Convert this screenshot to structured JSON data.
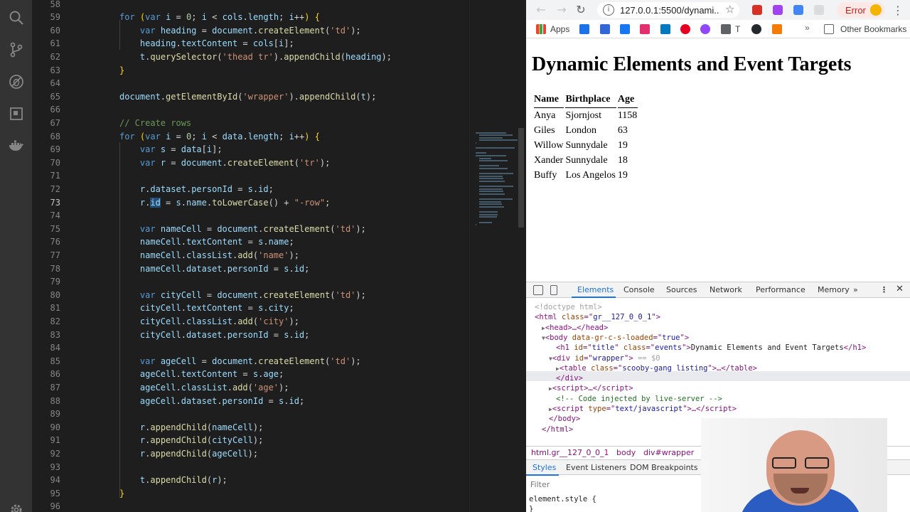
{
  "editor": {
    "lines": [
      {
        "n": "58",
        "html": ""
      },
      {
        "n": "59",
        "html": "<span class=\"k\">for</span> <span class=\"y\">(</span><span class=\"k\">var</span> <span class=\"v\">i</span> = <span class=\"n\">0</span>; <span class=\"v\">i</span> &lt; <span class=\"v\">cols</span>.<span class=\"v\">length</span>; <span class=\"v\">i</span>++<span class=\"y\">)</span> <span class=\"y\">{</span>"
      },
      {
        "n": "60",
        "html": "    <span class=\"k\">var</span> <span class=\"v\">heading</span> = <span class=\"v\">document</span>.<span class=\"f\">createElement</span>(<span class=\"s\">'td'</span>);"
      },
      {
        "n": "61",
        "html": "    <span class=\"v\">heading</span>.<span class=\"v\">textContent</span> = <span class=\"v\">cols</span>[<span class=\"v\">i</span>];"
      },
      {
        "n": "62",
        "html": "    <span class=\"v\">t</span>.<span class=\"f\">querySelector</span>(<span class=\"s\">'thead tr'</span>).<span class=\"f\">appendChild</span>(<span class=\"v\">heading</span>);"
      },
      {
        "n": "63",
        "html": "<span class=\"y\">}</span>"
      },
      {
        "n": "64",
        "html": ""
      },
      {
        "n": "65",
        "html": "<span class=\"v\">document</span>.<span class=\"f\">getElementById</span>(<span class=\"s\">'wrapper'</span>).<span class=\"f\">appendChild</span>(<span class=\"v\">t</span>);"
      },
      {
        "n": "66",
        "html": ""
      },
      {
        "n": "67",
        "html": "<span class=\"c\">// Create rows</span>"
      },
      {
        "n": "68",
        "html": "<span class=\"k\">for</span> <span class=\"y\">(</span><span class=\"k\">var</span> <span class=\"v\">i</span> = <span class=\"n\">0</span>; <span class=\"v\">i</span> &lt; <span class=\"v\">data</span>.<span class=\"v\">length</span>; <span class=\"v\">i</span>++<span class=\"y\">)</span> <span class=\"y\">{</span>"
      },
      {
        "n": "69",
        "html": "    <span class=\"k\">var</span> <span class=\"v\">s</span> = <span class=\"v\">data</span>[<span class=\"v\">i</span>];"
      },
      {
        "n": "70",
        "html": "    <span class=\"k\">var</span> <span class=\"v\">r</span> = <span class=\"v\">document</span>.<span class=\"f\">createElement</span>(<span class=\"s\">'tr'</span>);"
      },
      {
        "n": "71",
        "html": ""
      },
      {
        "n": "72",
        "html": "    <span class=\"v\">r</span>.<span class=\"v\">dataset</span>.<span class=\"v\">personId</span> = <span class=\"v\">s</span>.<span class=\"v\">id</span>;"
      },
      {
        "n": "73",
        "html": "    <span class=\"v\">r</span>.<span class=\"v hl\">id</span> = <span class=\"v\">s</span>.<span class=\"v\">name</span>.<span class=\"f\">toLowerCase</span>() + <span class=\"s\">\"-row\"</span>;",
        "active": true
      },
      {
        "n": "74",
        "html": ""
      },
      {
        "n": "75",
        "html": "    <span class=\"k\">var</span> <span class=\"v\">nameCell</span> = <span class=\"v\">document</span>.<span class=\"f\">createElement</span>(<span class=\"s\">'td'</span>);"
      },
      {
        "n": "76",
        "html": "    <span class=\"v\">nameCell</span>.<span class=\"v\">textContent</span> = <span class=\"v\">s</span>.<span class=\"v\">name</span>;"
      },
      {
        "n": "77",
        "html": "    <span class=\"v\">nameCell</span>.<span class=\"v\">classList</span>.<span class=\"f\">add</span>(<span class=\"s\">'name'</span>);"
      },
      {
        "n": "78",
        "html": "    <span class=\"v\">nameCell</span>.<span class=\"v\">dataset</span>.<span class=\"v\">personId</span> = <span class=\"v\">s</span>.<span class=\"v\">id</span>;"
      },
      {
        "n": "79",
        "html": ""
      },
      {
        "n": "80",
        "html": "    <span class=\"k\">var</span> <span class=\"v\">cityCell</span> = <span class=\"v\">document</span>.<span class=\"f\">createElement</span>(<span class=\"s\">'td'</span>);"
      },
      {
        "n": "81",
        "html": "    <span class=\"v\">cityCell</span>.<span class=\"v\">textContent</span> = <span class=\"v\">s</span>.<span class=\"v\">city</span>;"
      },
      {
        "n": "82",
        "html": "    <span class=\"v\">cityCell</span>.<span class=\"v\">classList</span>.<span class=\"f\">add</span>(<span class=\"s\">'city'</span>);"
      },
      {
        "n": "83",
        "html": "    <span class=\"v\">cityCell</span>.<span class=\"v\">dataset</span>.<span class=\"v\">personId</span> = <span class=\"v\">s</span>.<span class=\"v\">id</span>;"
      },
      {
        "n": "84",
        "html": ""
      },
      {
        "n": "85",
        "html": "    <span class=\"k\">var</span> <span class=\"v\">ageCell</span> = <span class=\"v\">document</span>.<span class=\"f\">createElement</span>(<span class=\"s\">'td'</span>);"
      },
      {
        "n": "86",
        "html": "    <span class=\"v\">ageCell</span>.<span class=\"v\">textContent</span> = <span class=\"v\">s</span>.<span class=\"v\">age</span>;"
      },
      {
        "n": "87",
        "html": "    <span class=\"v\">ageCell</span>.<span class=\"v\">classList</span>.<span class=\"f\">add</span>(<span class=\"s\">'age'</span>);"
      },
      {
        "n": "88",
        "html": "    <span class=\"v\">ageCell</span>.<span class=\"v\">dataset</span>.<span class=\"v\">personId</span> = <span class=\"v\">s</span>.<span class=\"v\">id</span>;"
      },
      {
        "n": "89",
        "html": ""
      },
      {
        "n": "90",
        "html": "    <span class=\"v\">r</span>.<span class=\"f\">appendChild</span>(<span class=\"v\">nameCell</span>);"
      },
      {
        "n": "91",
        "html": "    <span class=\"v\">r</span>.<span class=\"f\">appendChild</span>(<span class=\"v\">cityCell</span>);"
      },
      {
        "n": "92",
        "html": "    <span class=\"v\">r</span>.<span class=\"f\">appendChild</span>(<span class=\"v\">ageCell</span>);"
      },
      {
        "n": "93",
        "html": ""
      },
      {
        "n": "94",
        "html": "    <span class=\"v\">t</span>.<span class=\"f\">appendChild</span>(<span class=\"v\">r</span>);"
      },
      {
        "n": "95",
        "html": "<span class=\"y\">}</span>"
      },
      {
        "n": "96",
        "html": ""
      }
    ]
  },
  "activity_icons": [
    "search-icon",
    "source-control-icon",
    "debug-icon",
    "extensions-icon",
    "docker-icon",
    "settings-gear-icon"
  ],
  "browser": {
    "url": "127.0.0.1:5500/dynami...",
    "error_label": "Error",
    "bookmarks": {
      "apps_label": "Apps",
      "t_label": "T",
      "more": "»",
      "other": "Other Bookmarks"
    },
    "page": {
      "title": "Dynamic Elements and Event Targets",
      "table": {
        "headers": [
          "Name",
          "Birthplace",
          "Age"
        ],
        "rows": [
          [
            "Anya",
            "Sjornjost",
            "1158"
          ],
          [
            "Giles",
            "London",
            "63"
          ],
          [
            "Willow",
            "Sunnydale",
            "19"
          ],
          [
            "Xander",
            "Sunnydale",
            "18"
          ],
          [
            "Buffy",
            "Los Angelos",
            "19"
          ]
        ]
      }
    }
  },
  "devtools": {
    "tabs": [
      "Elements",
      "Console",
      "Sources",
      "Network",
      "Performance",
      "Memory"
    ],
    "more_tabs": "»",
    "dom": [
      {
        "indent": 0,
        "html": "<span class=\"dim\">&lt;!doctype html&gt;</span>"
      },
      {
        "indent": 0,
        "html": "&lt;html <span class=\"at\">class</span>=\"<span class=\"av\">gr__127_0_0_1</span>\"&gt;"
      },
      {
        "indent": 1,
        "html": "<span class=\"tri\">▶</span>&lt;head&gt;…&lt;/head&gt;"
      },
      {
        "indent": 1,
        "html": "<span class=\"tri\">▼</span>&lt;body <span class=\"at\">data-gr-c-s-loaded</span>=\"<span class=\"av\">true</span>\"&gt;"
      },
      {
        "indent": 3,
        "html": "&lt;h1 <span class=\"at\">id</span>=\"<span class=\"av\">title</span>\" <span class=\"at\">class</span>=\"<span class=\"av\">events</span>\"&gt;<span class=\"tx\">Dynamic Elements and Event Targets</span>&lt;/h1&gt;"
      },
      {
        "indent": 2,
        "html": "<span class=\"tri\">▼</span>&lt;div <span class=\"at\">id</span>=\"<span class=\"av\">wrapper</span>\"&gt; <span class=\"dim\">== $0</span>"
      },
      {
        "indent": 3,
        "html": "<span class=\"tri\">▶</span>&lt;table <span class=\"at\">class</span>=\"<span class=\"av\">scooby-gang listing</span>\"&gt;…&lt;/table&gt;"
      },
      {
        "indent": 3,
        "html": "&lt;/div&gt;"
      },
      {
        "indent": 2,
        "html": "<span class=\"tri\">▶</span>&lt;script&gt;…&lt;/script&gt;"
      },
      {
        "indent": 3,
        "html": "<span class=\"cm\">&lt;!-- Code injected by live-server --&gt;</span>"
      },
      {
        "indent": 2,
        "html": "<span class=\"tri\">▶</span>&lt;script <span class=\"at\">type</span>=\"<span class=\"av\">text/javascript</span>\"&gt;…&lt;/script&gt;"
      },
      {
        "indent": 2,
        "html": "&lt;/body&gt;"
      },
      {
        "indent": 1,
        "html": "&lt;/html&gt;"
      }
    ],
    "breadcrumbs": [
      "html.gr__127_0_0_1",
      "body",
      "div#wrapper"
    ],
    "sub_tabs": [
      "Styles",
      "Event Listeners",
      "DOM Breakpoints"
    ],
    "filter_placeholder": "Filter",
    "element_style": "element.style {\n}"
  },
  "colors": {
    "editor_bg": "#1e1e1e",
    "keyword": "#569cd6",
    "string": "#ce9178",
    "devtools_accent": "#1a73e8"
  }
}
